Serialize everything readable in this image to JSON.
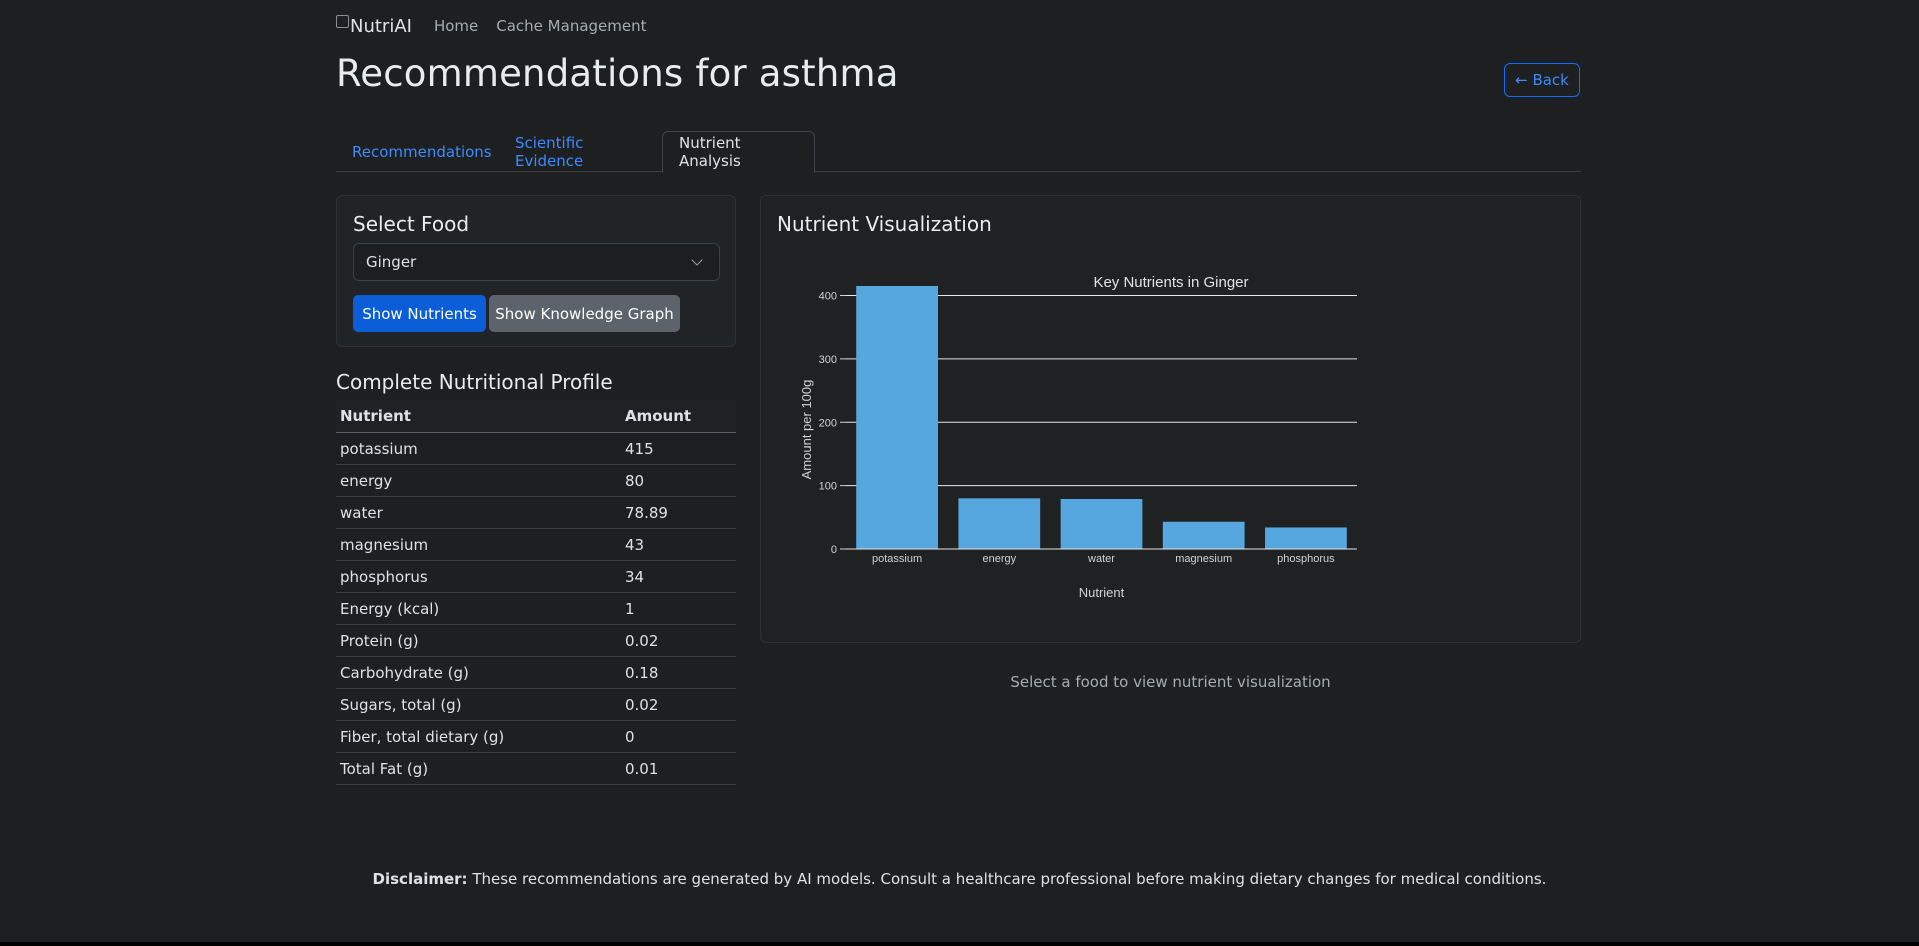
{
  "nav": {
    "brand_alt": "NutriAI",
    "links": [
      "Home",
      "Cache Management"
    ]
  },
  "page": {
    "title": "Recommendations for asthma",
    "back_label": "← Back"
  },
  "tabs": [
    {
      "label": "Recommendations",
      "active": false
    },
    {
      "label": "Scientific Evidence",
      "active": false
    },
    {
      "label": "Nutrient Analysis",
      "active": true
    }
  ],
  "select_food": {
    "title": "Select Food",
    "selected": "Ginger",
    "show_nutrients_label": "Show Nutrients",
    "show_graph_label": "Show Knowledge Graph"
  },
  "profile": {
    "title": "Complete Nutritional Profile",
    "headers": [
      "Nutrient",
      "Amount"
    ],
    "rows": [
      [
        "potassium",
        "415"
      ],
      [
        "energy",
        "80"
      ],
      [
        "water",
        "78.89"
      ],
      [
        "magnesium",
        "43"
      ],
      [
        "phosphorus",
        "34"
      ],
      [
        "Energy (kcal)",
        "1"
      ],
      [
        "Protein (g)",
        "0.02"
      ],
      [
        "Carbohydrate (g)",
        "0.18"
      ],
      [
        "Sugars, total (g)",
        "0.02"
      ],
      [
        "Fiber, total dietary (g)",
        "0"
      ],
      [
        "Total Fat (g)",
        "0.01"
      ]
    ]
  },
  "visualization": {
    "title": "Nutrient Visualization",
    "empty_message": "Select a food to view nutrient visualization"
  },
  "chart_data": {
    "type": "bar",
    "title": "Key Nutrients in Ginger",
    "xlabel": "Nutrient",
    "ylabel": "Amount per 100g",
    "categories": [
      "potassium",
      "energy",
      "water",
      "magnesium",
      "phosphorus"
    ],
    "values": [
      415,
      80,
      78.89,
      43,
      34
    ],
    "ylim": [
      0,
      415
    ],
    "yticks": [
      0,
      100,
      200,
      300,
      400
    ],
    "grid": true,
    "bar_color": "#56a6e0"
  },
  "footer": {
    "disclaimer_label": "Disclaimer:",
    "disclaimer_text": " These recommendations are generated by AI models. Consult a healthcare professional before making dietary changes for medical conditions."
  }
}
